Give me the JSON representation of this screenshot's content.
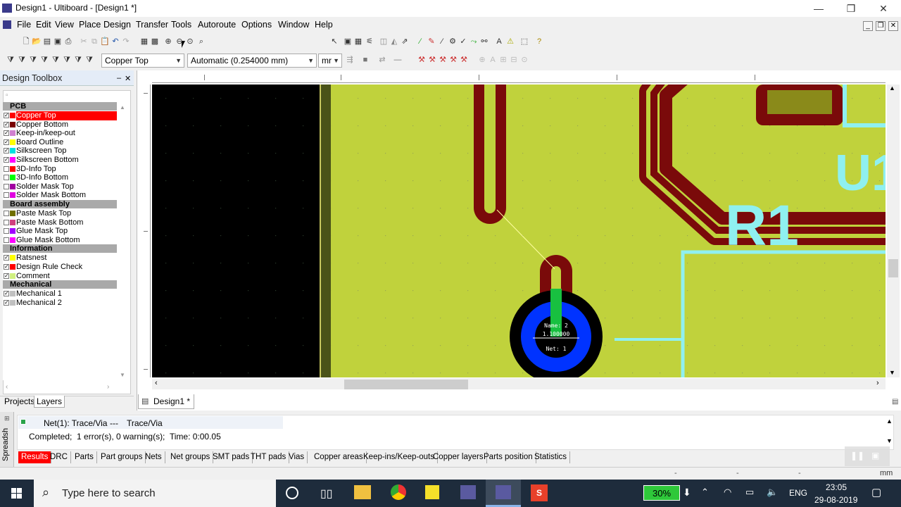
{
  "window": {
    "title": "Design1 - Ultiboard - [Design1 *]",
    "minimize": "—",
    "restore": "❒",
    "close": "✕"
  },
  "menu": [
    "File",
    "Edit",
    "View",
    "Place",
    "Design",
    "Transfer",
    "Tools",
    "Autoroute",
    "Options",
    "Window",
    "Help"
  ],
  "toolbar": {
    "layer_select": "Copper Top",
    "trace_width": "Automatic (0.254000 mm)",
    "units": "mr"
  },
  "toolbox": {
    "title": "Design Toolbox",
    "pin": "–",
    "close": "✕",
    "sections": [
      {
        "name": "PCB",
        "layers": [
          {
            "label": "Copper Top",
            "color": "#ff0000",
            "checked": true,
            "selected": true
          },
          {
            "label": "Copper Bottom",
            "color": "#7a0000",
            "checked": true
          },
          {
            "label": "Keep-in/keep-out",
            "color": "#d080d0",
            "checked": true
          },
          {
            "label": "Board Outline",
            "color": "#ffff00",
            "checked": true
          },
          {
            "label": "Silkscreen Top",
            "color": "#00e0e0",
            "checked": true
          },
          {
            "label": "Silkscreen Bottom",
            "color": "#ff00ff",
            "checked": true
          },
          {
            "label": "3D-Info Top",
            "color": "#ff0000",
            "checked": false
          },
          {
            "label": "3D-Info Bottom",
            "color": "#00ff00",
            "checked": false
          },
          {
            "label": "Solder Mask Top",
            "color": "#a000a0",
            "checked": false
          },
          {
            "label": "Solder Mask Bottom",
            "color": "#e000e0",
            "checked": false
          }
        ]
      },
      {
        "name": "Board assembly",
        "layers": [
          {
            "label": "Paste Mask Top",
            "color": "#707000",
            "checked": false
          },
          {
            "label": "Paste Mask Bottom",
            "color": "#d04080",
            "checked": false
          },
          {
            "label": "Glue Mask Top",
            "color": "#a000ff",
            "checked": false
          },
          {
            "label": "Glue Mask Bottom",
            "color": "#ff00ff",
            "checked": false
          }
        ]
      },
      {
        "name": "Information",
        "layers": [
          {
            "label": "Ratsnest",
            "color": "#ffff00",
            "checked": true
          },
          {
            "label": "Design Rule Check",
            "color": "#ff0000",
            "checked": true
          },
          {
            "label": "Comment",
            "color": "#d0f080",
            "checked": true
          }
        ]
      },
      {
        "name": "Mechanical",
        "layers": [
          {
            "label": "Mechanical 1",
            "color": "#c0c0c0",
            "checked": true
          },
          {
            "label": "Mechanical 2",
            "color": "#c0c0c0",
            "checked": true
          }
        ]
      }
    ],
    "tabs": [
      "Projects",
      "Layers"
    ]
  },
  "document_tab": "Design1 *",
  "pad": {
    "name": "Name: 2",
    "value": "1.100000",
    "net": "Net: 1"
  },
  "silkscreen": {
    "ref_r1": "R1",
    "ref_u": "U1"
  },
  "results": {
    "side_label": "Spreadsh",
    "line1_net": "Net(1): Trace/Via",
    "line1_sep": "---",
    "line1_type": "Trace/Via",
    "line2": "Completed;  1 error(s), 0 warning(s);  Time: 0:00.05",
    "tabs": [
      "Results",
      "DRC",
      "Parts",
      "Part groups",
      "Nets",
      "Net groups",
      "SMT pads",
      "THT pads",
      "Vias",
      "Copper areas",
      "Keep-ins/Keep-outs",
      "Copper layers",
      "Parts position",
      "Statistics"
    ]
  },
  "statusbar": {
    "dash1": "-",
    "dash2": "-",
    "dash3": "-",
    "units": "mm"
  },
  "taskbar": {
    "search_placeholder": "Type here to search",
    "battery": "30%",
    "lang": "ENG",
    "time": "23:05",
    "date": "29-08-2019"
  },
  "colors": {
    "board": "#c0d23c",
    "copper_top": "#7a0a0a",
    "silkscreen": "#8ff0f0",
    "via_blue": "#0033ff",
    "via_green": "#18c040",
    "selected_layer": "#ff0000"
  }
}
